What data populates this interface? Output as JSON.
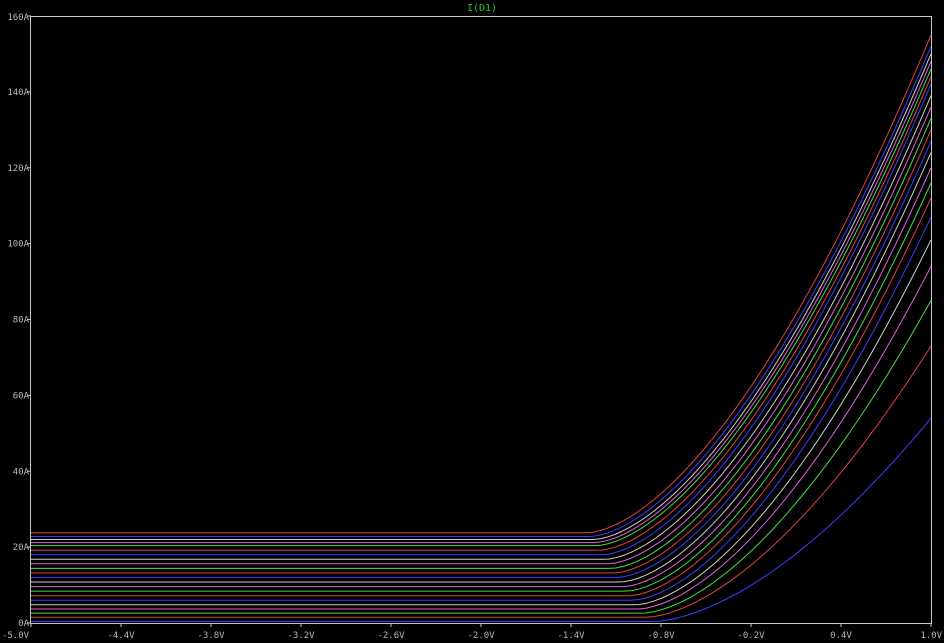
{
  "chart_data": {
    "type": "line",
    "title": "I(D1)",
    "xlabel": "",
    "ylabel": "",
    "xlim": [
      -5.0,
      1.0
    ],
    "ylim": [
      0,
      160
    ],
    "x_ticks": [
      "-5.0V",
      "-4.4V",
      "-3.8V",
      "-3.2V",
      "-2.6V",
      "-2.0V",
      "-1.4V",
      "-0.8V",
      "-0.2V",
      "0.4V",
      "1.0V"
    ],
    "x_tick_values": [
      -5.0,
      -4.4,
      -3.8,
      -3.2,
      -2.6,
      -2.0,
      -1.4,
      -0.8,
      -0.2,
      0.4,
      1.0
    ],
    "y_ticks": [
      "0A",
      "20A",
      "40A",
      "60A",
      "80A",
      "100A",
      "120A",
      "140A",
      "160A"
    ],
    "y_tick_values": [
      0,
      20,
      40,
      60,
      80,
      100,
      120,
      140,
      160
    ],
    "grid": false,
    "series": [
      {
        "color": "#3c3cff",
        "flat": 0.4,
        "knee": -0.85,
        "end": 54
      },
      {
        "color": "#e04040",
        "flat": 1.5,
        "knee": -0.9,
        "end": 73
      },
      {
        "color": "#40e040",
        "flat": 2.6,
        "knee": -0.92,
        "end": 85
      },
      {
        "color": "#e060e0",
        "flat": 3.7,
        "knee": -0.95,
        "end": 94
      },
      {
        "color": "#d0d0d0",
        "flat": 4.8,
        "knee": -0.97,
        "end": 101
      },
      {
        "color": "#3c3cff",
        "flat": 6.0,
        "knee": -0.99,
        "end": 107
      },
      {
        "color": "#e04040",
        "flat": 7.2,
        "knee": -1.01,
        "end": 112
      },
      {
        "color": "#40e040",
        "flat": 8.4,
        "knee": -1.03,
        "end": 116
      },
      {
        "color": "#e060e0",
        "flat": 9.6,
        "knee": -1.05,
        "end": 120
      },
      {
        "color": "#d0d0d0",
        "flat": 10.8,
        "knee": -1.07,
        "end": 124
      },
      {
        "color": "#3c3cff",
        "flat": 12.0,
        "knee": -1.09,
        "end": 127
      },
      {
        "color": "#e04040",
        "flat": 13.2,
        "knee": -1.11,
        "end": 130
      },
      {
        "color": "#40e040",
        "flat": 14.4,
        "knee": -1.13,
        "end": 133
      },
      {
        "color": "#e060e0",
        "flat": 15.6,
        "knee": -1.15,
        "end": 136
      },
      {
        "color": "#d0d0d0",
        "flat": 16.8,
        "knee": -1.17,
        "end": 139
      },
      {
        "color": "#3c3cff",
        "flat": 18.0,
        "knee": -1.19,
        "end": 142
      },
      {
        "color": "#e04040",
        "flat": 19.2,
        "knee": -1.21,
        "end": 144
      },
      {
        "color": "#40e040",
        "flat": 20.4,
        "knee": -1.23,
        "end": 146
      },
      {
        "color": "#e060e0",
        "flat": 21.2,
        "knee": -1.24,
        "end": 148
      },
      {
        "color": "#d0d0d0",
        "flat": 22.0,
        "knee": -1.25,
        "end": 150
      },
      {
        "color": "#3c3cff",
        "flat": 22.8,
        "knee": -1.27,
        "end": 152
      },
      {
        "color": "#e04040",
        "flat": 23.8,
        "knee": -1.29,
        "end": 155
      }
    ]
  }
}
